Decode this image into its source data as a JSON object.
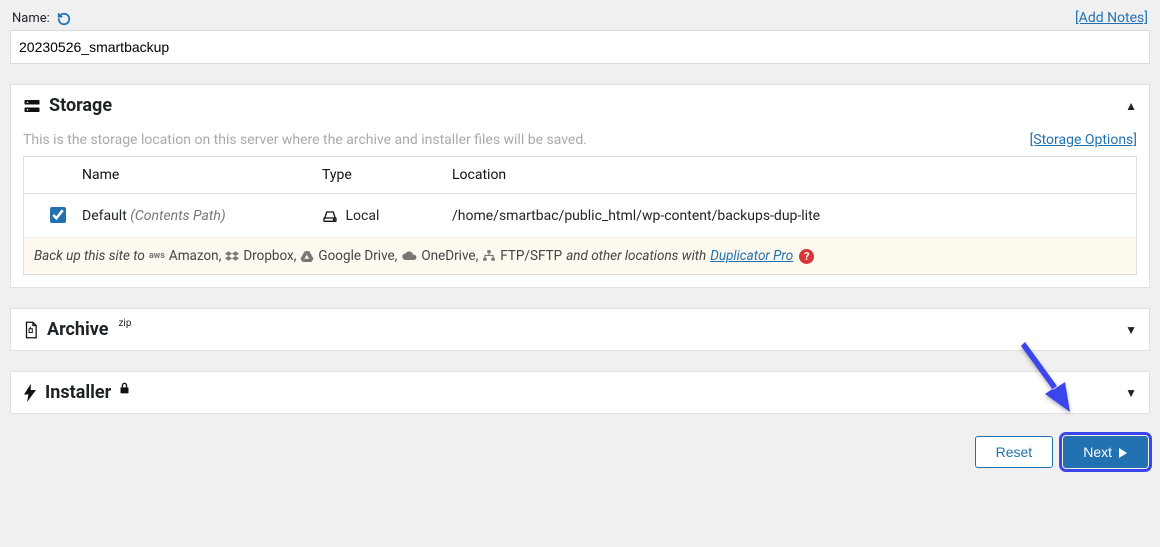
{
  "name": {
    "label": "Name:",
    "value": "20230526_smartbackup",
    "add_notes": "[Add Notes]"
  },
  "storage": {
    "title": "Storage",
    "desc": "This is the storage location on this server where the archive and installer files will be saved.",
    "options_link": "[Storage Options]",
    "columns": {
      "name": "Name",
      "type": "Type",
      "location": "Location"
    },
    "rows": [
      {
        "checked": true,
        "name": "Default",
        "name_suffix": "(Contents Path)",
        "type": "Local",
        "location": "/home/smartbac/public_html/wp-content/backups-dup-lite"
      }
    ],
    "foot": {
      "prefix": "Back up this site to",
      "services": [
        "Amazon,",
        "Dropbox,",
        "Google Drive,",
        "OneDrive,",
        "FTP/SFTP"
      ],
      "suffix": "and other locations with",
      "pro": "Duplicator Pro"
    }
  },
  "archive": {
    "title": "Archive",
    "sup": "zip"
  },
  "installer": {
    "title": "Installer"
  },
  "buttons": {
    "reset": "Reset",
    "next": "Next"
  }
}
